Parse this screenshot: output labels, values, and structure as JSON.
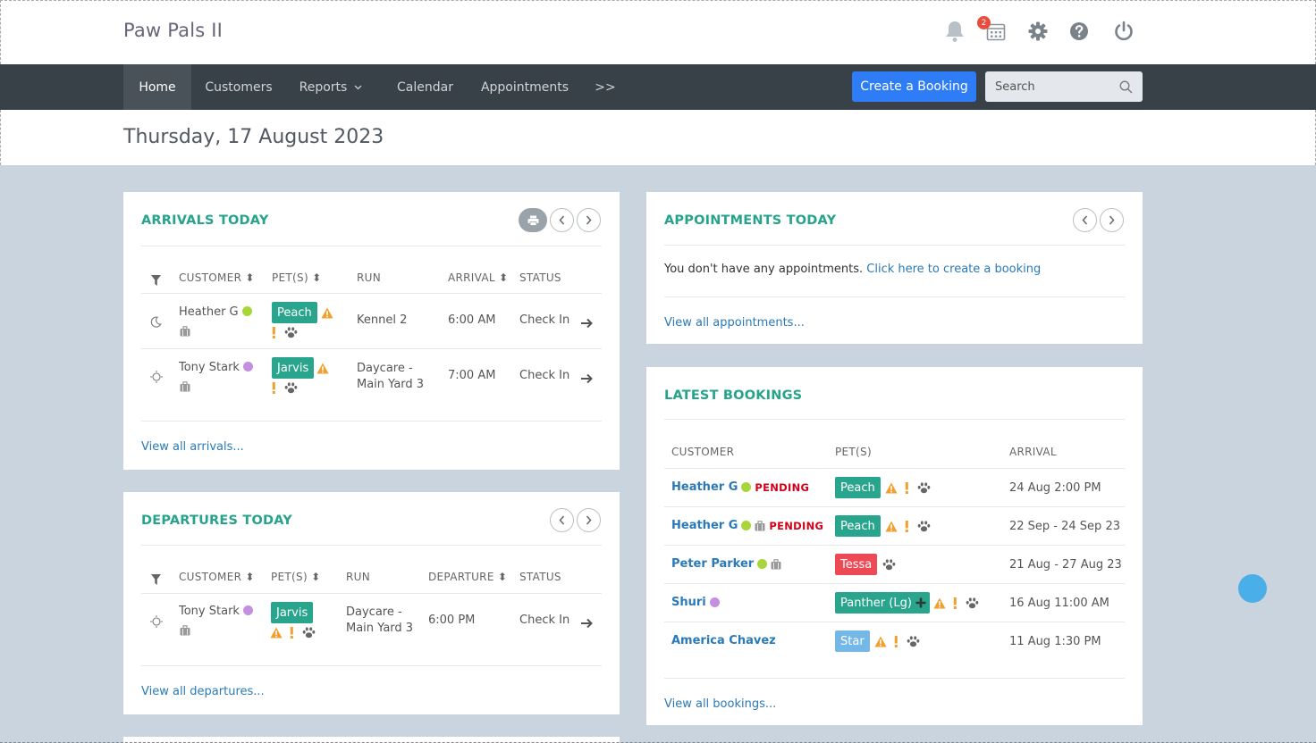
{
  "app": {
    "name": "Paw Pals II",
    "notification_count": "2"
  },
  "nav": {
    "items": [
      "Home",
      "Customers",
      "Reports",
      "Calendar",
      "Appointments",
      ">>"
    ],
    "create_label": "Create a Booking",
    "search_placeholder": "Search"
  },
  "date_heading": "Thursday, 17 August 2023",
  "arrivals": {
    "title": "ARRIVALS TODAY",
    "columns": [
      "CUSTOMER",
      "PET(S)",
      "RUN",
      "ARRIVAL",
      "STATUS"
    ],
    "rows": [
      {
        "customer": "Heather G",
        "dot": "#a8d63a",
        "pet": "Peach",
        "run": "Kennel 2",
        "run2": "",
        "time": "6:00 AM",
        "status": "Check In"
      },
      {
        "customer": "Tony Stark",
        "dot": "#c48fe0",
        "pet": "Jarvis",
        "run": "Daycare -",
        "run2": "Main Yard 3",
        "time": "7:00 AM",
        "status": "Check In"
      }
    ],
    "view_all": "View all arrivals..."
  },
  "departures": {
    "title": "DEPARTURES TODAY",
    "columns": [
      "CUSTOMER",
      "PET(S)",
      "RUN",
      "DEPARTURE",
      "STATUS"
    ],
    "rows": [
      {
        "customer": "Tony Stark",
        "dot": "#c48fe0",
        "pet": "Jarvis",
        "run": "Daycare -",
        "run2": "Main Yard 3",
        "time": "6:00 PM",
        "status": "Check In"
      }
    ],
    "view_all": "View all departures..."
  },
  "appointments": {
    "title": "APPOINTMENTS TODAY",
    "empty_text": "You don't have any appointments.",
    "create_link": "Click here to create a booking",
    "view_all": "View all appointments..."
  },
  "bookings": {
    "title": "LATEST BOOKINGS",
    "columns": [
      "CUSTOMER",
      "PET(S)",
      "ARRIVAL"
    ],
    "rows": [
      {
        "customer": "Heather G",
        "status": "PENDING",
        "pet": "Peach",
        "arrival": "24 Aug 2:00 PM"
      },
      {
        "customer": "Heather G",
        "status": "PENDING",
        "pet": "Peach",
        "arrival": "22 Sep - 24 Sep 23"
      },
      {
        "customer": "Peter Parker",
        "status": "",
        "pet": "Tessa",
        "arrival": "21 Aug - 27 Aug 23"
      },
      {
        "customer": "Shuri",
        "status": "",
        "pet": "Panther (Lg)",
        "arrival": "16 Aug 11:00 AM"
      },
      {
        "customer": "America Chavez",
        "status": "",
        "pet": "Star",
        "arrival": "11 Aug 1:30 PM"
      }
    ],
    "view_all": "View all bookings..."
  },
  "colors": {
    "accent": "#27a38b",
    "primary": "#2e7cf6",
    "nav_bg": "#394148",
    "pet_teal": "#2aa58d",
    "pet_red": "#ee4a55",
    "pet_blue": "#74b8e8"
  }
}
